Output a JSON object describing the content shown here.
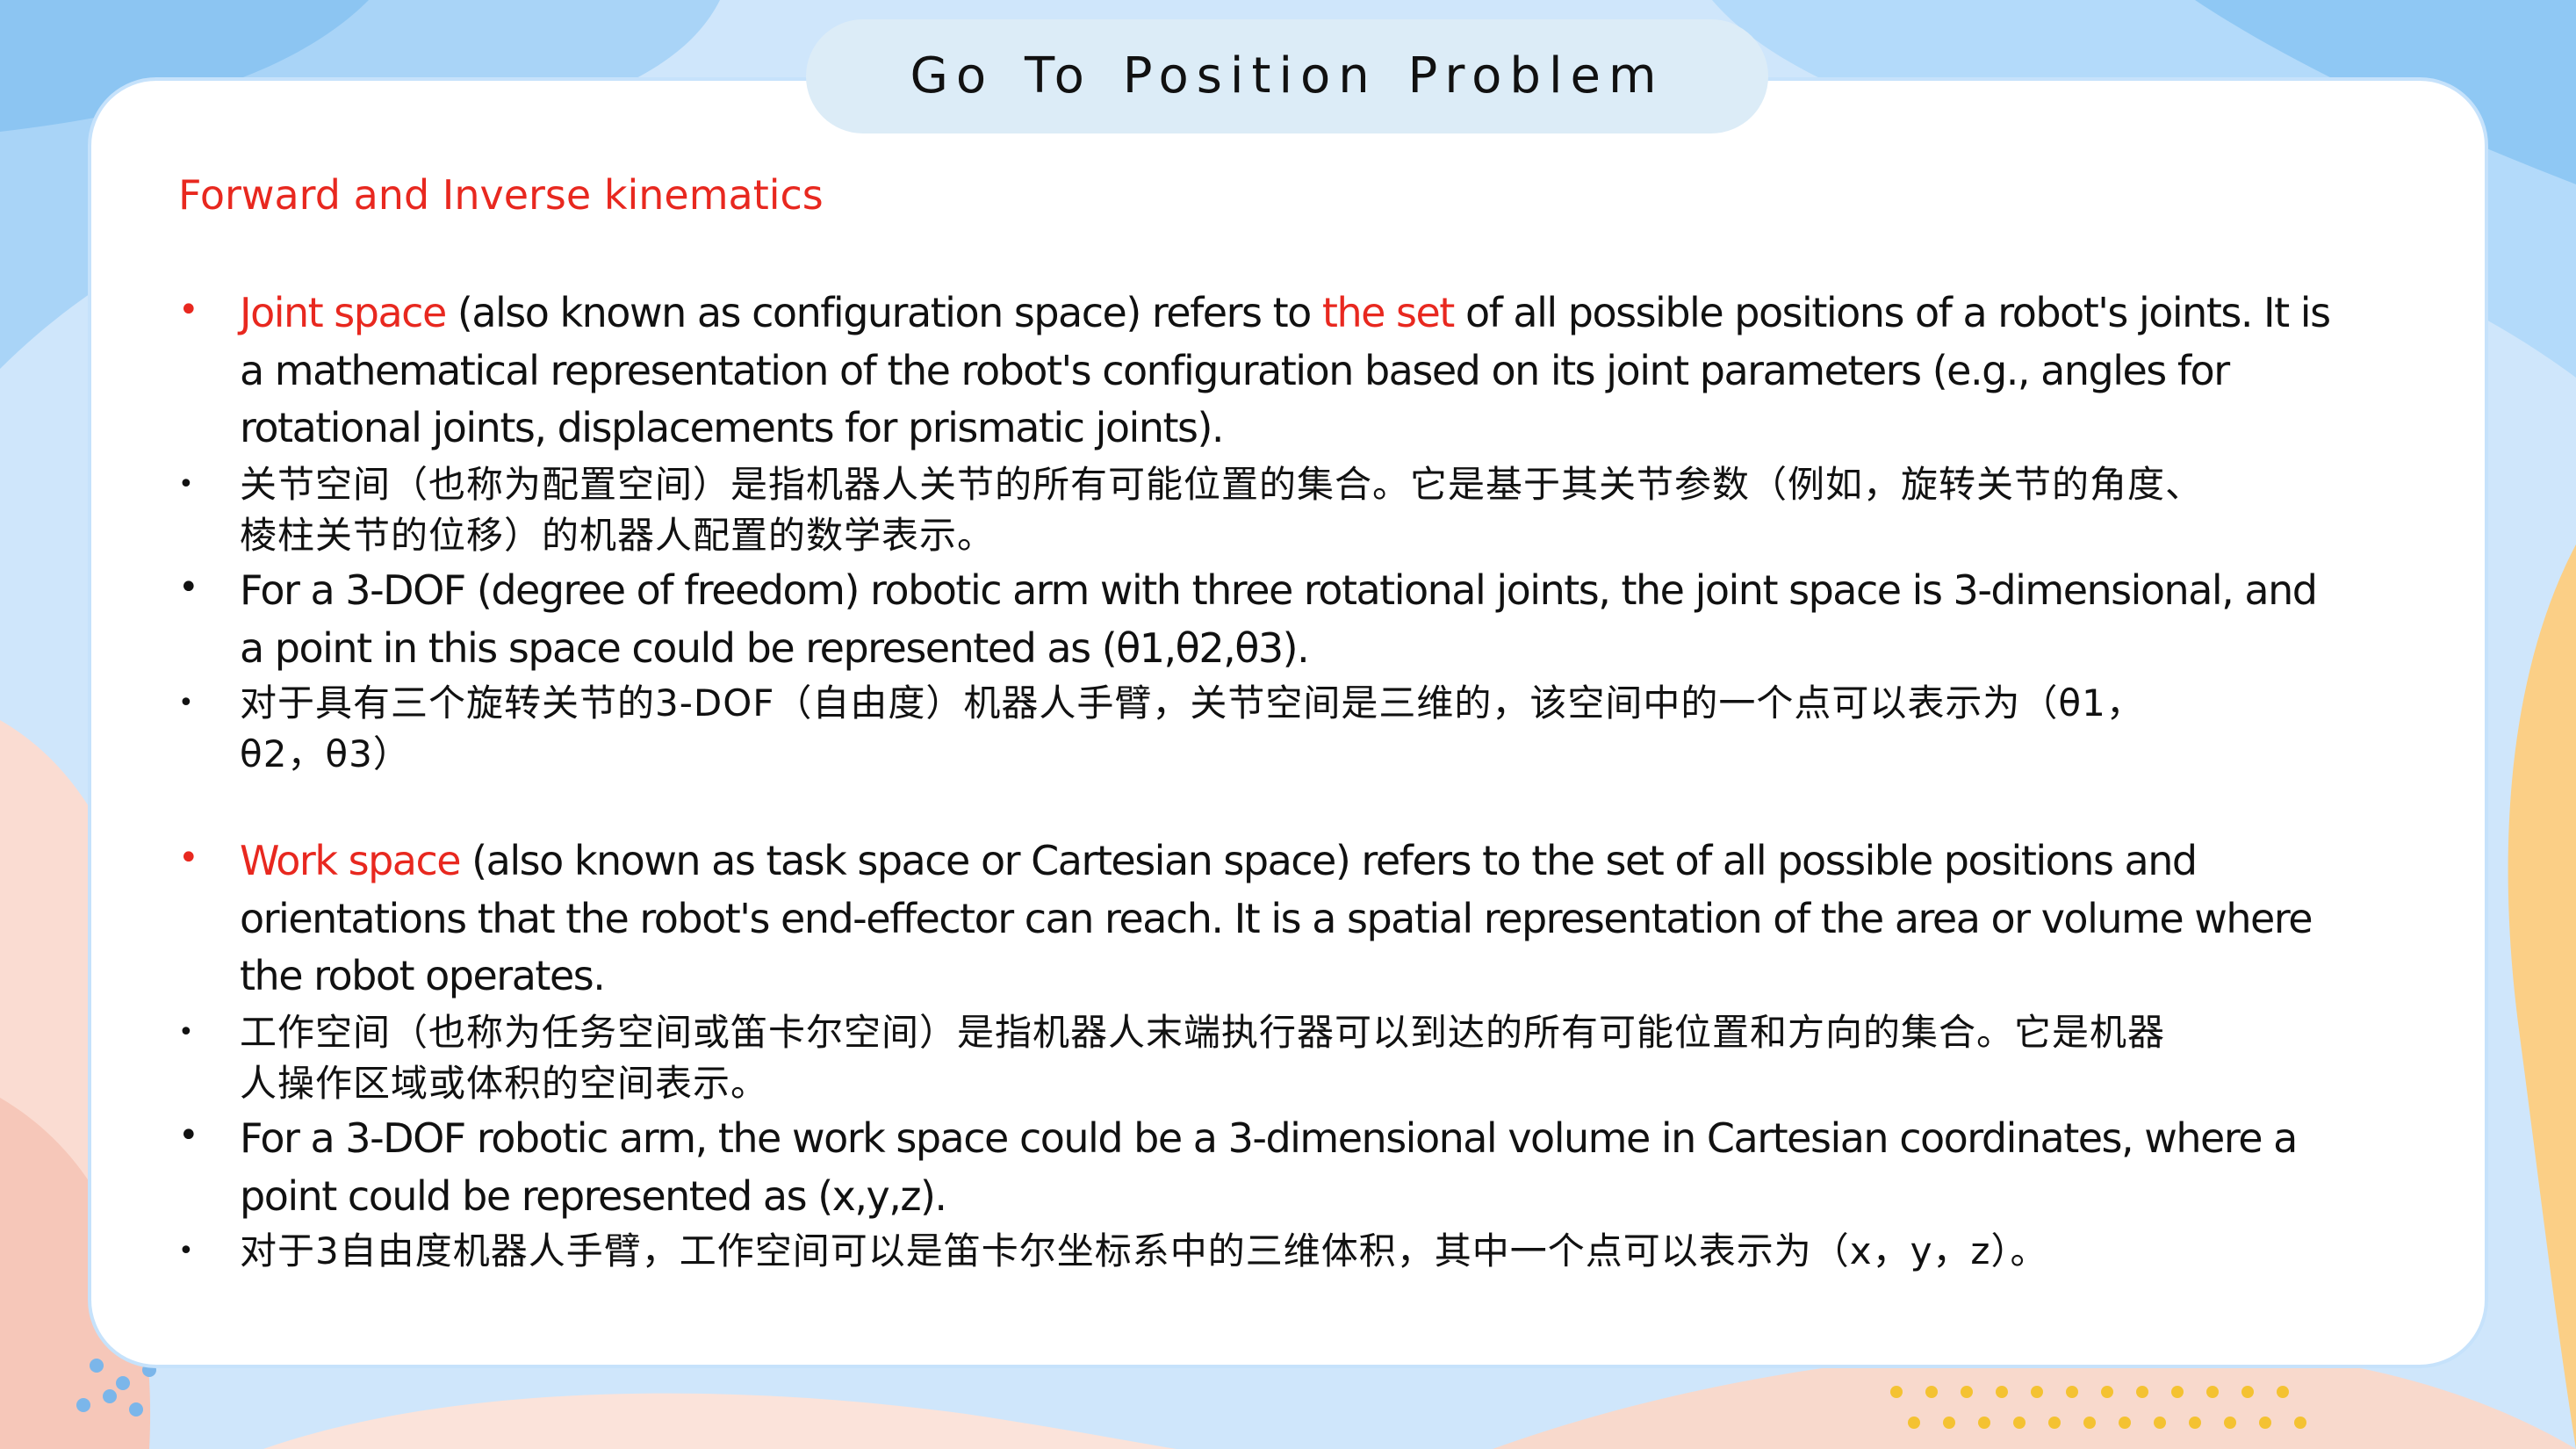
{
  "slide": {
    "title": "Go To Position Problem",
    "subheading": "Forward and Inverse kinematics",
    "accent_color": "#e8281f",
    "text_color": "#111111",
    "card_border_color": "#c6e2fb",
    "bullet_glyph": "•"
  },
  "joint_space": {
    "en_term": "Joint space",
    "en_part1": " (also known as configuration space) refers to ",
    "en_term2": "the set",
    "en_line1_rest": " of all possible positions of a robot's joints. It is",
    "en_line2": "a mathematical representation of the robot's configuration based on its joint parameters (e.g., angles for",
    "en_line3": "rotational joints, displacements for prismatic joints).",
    "zh_line1": "关节空间（也称为配置空间）是指机器人关节的所有可能位置的集合。它是基于其关节参数（例如，旋转关节的角度、",
    "zh_line2": "棱柱关节的位移）的机器人配置的数学表示。",
    "example_line1": "For a 3-DOF (degree of freedom) robotic arm with three rotational joints, the joint space is 3-dimensional, and",
    "example_line2": "a point in this space could be represented as (θ1,θ2,θ3).",
    "example_zh_line1": "对于具有三个旋转关节的3-DOF（自由度）机器人手臂，关节空间是三维的，该空间中的一个点可以表示为（θ1，",
    "example_zh_line2": "θ2，θ3）"
  },
  "work_space": {
    "en_term": "Work space",
    "en_line1_rest": " (also known as task space or Cartesian space) refers to the set of all possible positions and",
    "en_line2": "orientations that the robot's end-effector can reach. It is a spatial representation of the area or volume where",
    "en_line3": "the robot operates.",
    "zh_line1": "工作空间（也称为任务空间或笛卡尔空间）是指机器人末端执行器可以到达的所有可能位置和方向的集合。它是机器",
    "zh_line2": "人操作区域或体积的空间表示。",
    "example_line1": "For a 3-DOF robotic arm, the work space could be a 3-dimensional volume in Cartesian coordinates, where a",
    "example_line2": "point could be represented as (x,y,z).",
    "example_zh": "对于3自由度机器人手臂，工作空间可以是笛卡尔坐标系中的三维体积，其中一个点可以表示为（x，y，z）。"
  }
}
